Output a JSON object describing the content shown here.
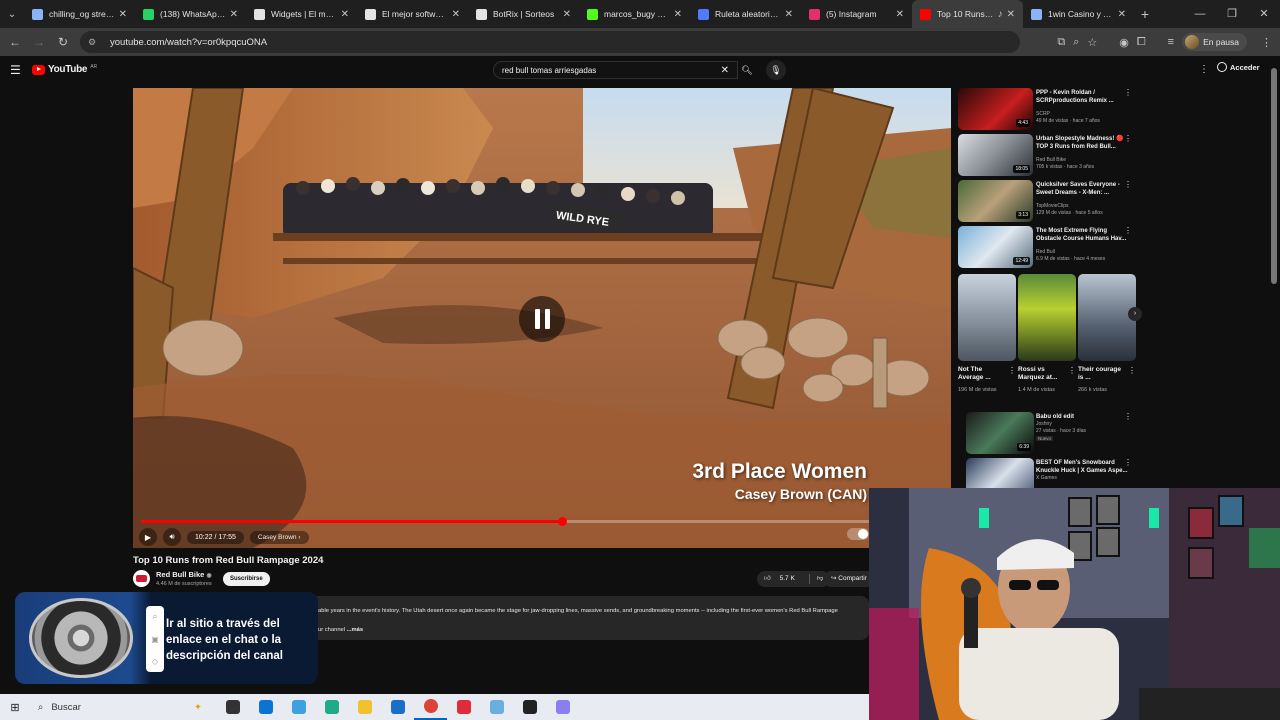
{
  "browser": {
    "tabs": [
      {
        "title": "chilling_og stream",
        "color": "#8ab4f8",
        "active": false
      },
      {
        "title": "(138) WhatsApp Business",
        "color": "#25d366",
        "active": false
      },
      {
        "title": "Widgets | El mejor",
        "color": "#e3e3e3",
        "active": false
      },
      {
        "title": "El mejor software",
        "color": "#e3e3e3",
        "active": false
      },
      {
        "title": "BotRix | Sorteos",
        "color": "#e3e3e3",
        "active": false
      },
      {
        "title": "marcos_bugy Stream",
        "color": "#53fc18",
        "active": false
      },
      {
        "title": "Ruleta aleatoria online",
        "color": "#4f7cff",
        "active": false
      },
      {
        "title": "(5) Instagram",
        "color": "#e1306c",
        "active": false
      },
      {
        "title": "Top 10 Runs from Red Bull",
        "color": "#ff0000",
        "active": true
      },
      {
        "title": "1win Casino y Apuestas",
        "color": "#8ab4f8",
        "active": false
      }
    ],
    "url": "youtube.com/watch?v=or0kpqcuONA",
    "profile_label": "En pausa"
  },
  "youtube": {
    "logo_text": "YouTube",
    "logo_suffix": "AR",
    "search_query": "red bull tomas arriesgadas",
    "signin_label": "Acceder"
  },
  "player": {
    "overlay_title": "3rd Place Women",
    "overlay_subtitle": "Casey Brown (CAN)",
    "time": "10:22 / 17:55",
    "chapter": "Casey Brown",
    "progress": 0.5787
  },
  "video": {
    "title": "Top 10 Runs from Red Bull Rampage 2024",
    "channel": "Red Bull Bike",
    "subscribers": "4.46 M de suscriptores",
    "subscribe_label": "Suscribirse",
    "likes": "5.7 K",
    "share_label": "Compartir",
    "description_line1": "able years in the event's history. The Utah desert once again became the stage for jaw-dropping lines, massive sends, and groundbreaking moments -- including the first-ever women's Red Bull Rampage",
    "description_line2": "ur channel ",
    "description_more": "...más"
  },
  "roulette_overlay": {
    "text": "Ir al sitio a través del enlace en el chat o la descripción del canal"
  },
  "recommendations": [
    {
      "title": "PPP - Kevin Roldan / SCRPproductions Remix ...",
      "channel": "SCRP",
      "meta": "49 M de vistas · hace 7 años",
      "duration": "4:43"
    },
    {
      "title": "Urban Slopestyle Madness! 🔴 TOP 3 Runs from Red Bull...",
      "channel": "Red Bull Bike",
      "meta": "705 k vistas · hace 3 años",
      "duration": "18:05"
    },
    {
      "title": "Quicksilver Saves Everyone - Sweet Dreams - X-Men: ...",
      "channel": "TopMovieClips",
      "meta": "129 M de vistas · hace 5 años",
      "duration": "3:13"
    },
    {
      "title": "The Most Extreme Flying Obstacle Course Humans Hav...",
      "channel": "Red Bull",
      "meta": "6.9 M de vistas · hace 4 meses",
      "duration": "12:49"
    }
  ],
  "shorts": [
    {
      "title": "Not The Average ...",
      "views": "196 M de vistas"
    },
    {
      "title": "Rossi vs Marquez at...",
      "views": "1.4 M de vistas"
    },
    {
      "title": "Their courage is ...",
      "views": "266 k vistas"
    }
  ],
  "recommendations_2": [
    {
      "title": "Babu old edit",
      "channel": "Joshny",
      "meta": "27 vistas · hace 3 días",
      "badge": "Nuevo",
      "duration": "6:39"
    },
    {
      "title": "BEST OF Men's Snowboard Knuckle Huck | X Games Aspe...",
      "channel": "X Games",
      "meta": "",
      "duration": ""
    }
  ],
  "taskbar": {
    "search_placeholder": "Buscar"
  }
}
